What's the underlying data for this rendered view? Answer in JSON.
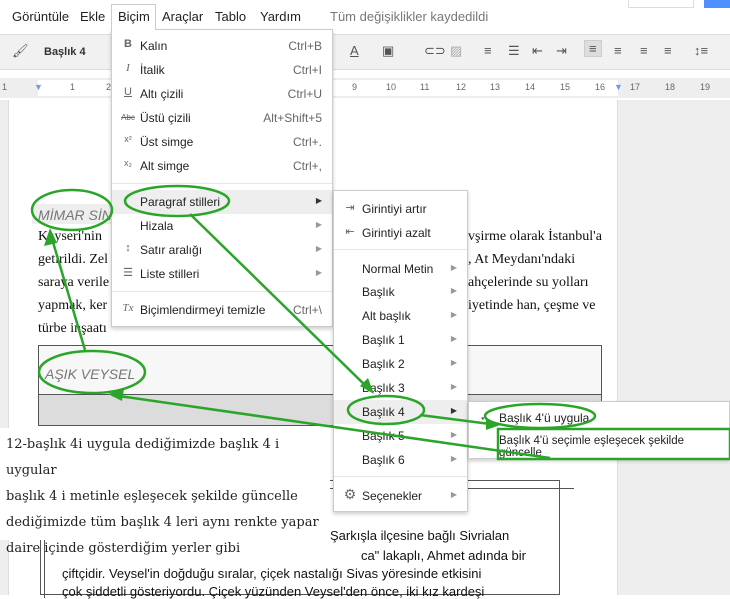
{
  "menubar": {
    "items": [
      "Görüntüle",
      "Ekle",
      "Biçim",
      "Araçlar",
      "Tablo",
      "Yardım"
    ],
    "status": "Tüm değişiklikler kaydedildi"
  },
  "toolbar": {
    "style": "Başlık 4"
  },
  "ruler": {
    "ticks": [
      "1",
      "1",
      "2",
      "9",
      "10",
      "11",
      "12",
      "13",
      "14",
      "15",
      "16",
      "17",
      "18",
      "19"
    ]
  },
  "format_menu": {
    "items": [
      {
        "icon": "bold-icon",
        "glyph": "B",
        "label": "Kalın",
        "shortcut": "Ctrl+B"
      },
      {
        "icon": "italic-icon",
        "glyph": "I",
        "label": "İtalik",
        "shortcut": "Ctrl+I"
      },
      {
        "icon": "underline-icon",
        "glyph": "U",
        "label": "Altı çizili",
        "shortcut": "Ctrl+U"
      },
      {
        "icon": "strikethrough-icon",
        "glyph": "Abc",
        "label": "Üstü çizili",
        "shortcut": "Alt+Shift+5"
      },
      {
        "icon": "superscript-icon",
        "glyph": "x²",
        "label": "Üst simge",
        "shortcut": "Ctrl+."
      },
      {
        "icon": "subscript-icon",
        "glyph": "x₂",
        "label": "Alt simge",
        "shortcut": "Ctrl+,"
      },
      {
        "label": "Paragraf stilleri"
      },
      {
        "label": "Hizala"
      },
      {
        "icon": "line-spacing-icon",
        "glyph": "↕",
        "label": "Satır aralığı"
      },
      {
        "icon": "list-icon",
        "glyph": "☰",
        "label": "Liste stilleri"
      },
      {
        "icon": "clear-formatting-icon",
        "glyph": "Tx",
        "label": "Biçimlendirmeyi temizle",
        "shortcut": "Ctrl+\\"
      }
    ]
  },
  "paragraph_menu": {
    "items": [
      "Girintiyi artır",
      "Girintiyi azalt",
      "Normal Metin",
      "Başlık",
      "Alt başlık",
      "Başlık 1",
      "Başlık 2",
      "Başlık 3",
      "Başlık 4",
      "Başlık 5",
      "Başlık 6",
      "Seçenekler"
    ]
  },
  "heading4_menu": {
    "items": [
      "Başlık 4'ü uygula",
      "Başlık 4'ü seçimle eşleşecek şekilde güncelle"
    ]
  },
  "document": {
    "heading1": "MİMAR SİN",
    "left_lines": [
      "Kayseri'nin",
      "getirildi. Zel",
      "saraya verile",
      "yapmak, ker",
      "türbe inşaatı"
    ],
    "right_lines": [
      "vşirme olarak İstanbul'a",
      ", At Meydanı'ndaki",
      "ahçelerinde su yolları",
      "iyetinde han, çeşme ve"
    ],
    "heading2": "AŞIK VEYSEL",
    "bottom_lines": [
      "Şarkışla ilçesine bağlı Sivrialan",
      "ca\" lakaplı, Ahmet adında bir",
      "çiftçidir. Veysel'in doğduğu sıralar, çiçek nastalığı Sivas yöresinde etkisini",
      "çok şiddetli gösteriyordu. Çiçek yüzünden Veysel'den önce, iki kız kardeşi"
    ]
  },
  "note": {
    "lines": [
      "12-başlık 4i uygula dediğimizde başlık 4 i uygular",
      "başlık 4 i metinle  eşleşecek şekilde güncelle",
      "dediğimizde tüm başlık 4 leri aynı renkte yapar",
      "daire içinde gösterdiğim yerler gibi"
    ]
  },
  "colors": {
    "annotation": "#2aa52a",
    "highlight": "#eeeeee"
  }
}
